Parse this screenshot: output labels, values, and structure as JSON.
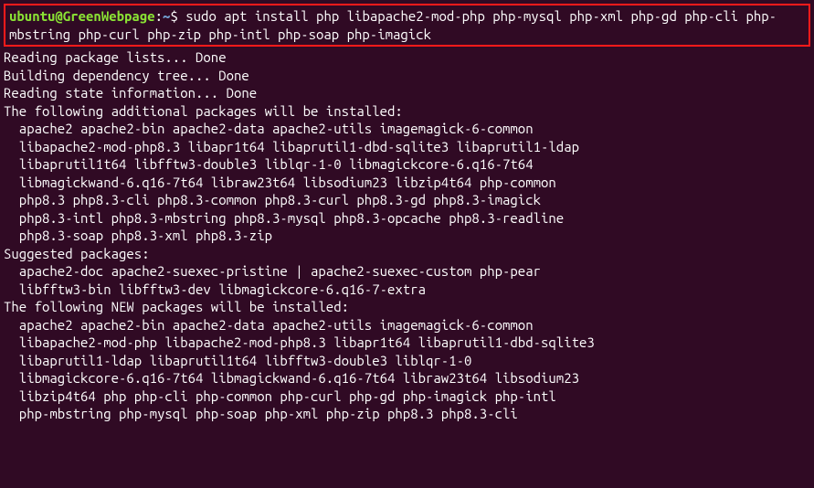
{
  "prompt": {
    "user": "ubuntu",
    "at": "@",
    "host": "GreenWebpage",
    "colon": ":",
    "path": "~",
    "dollar": "$ "
  },
  "command": "sudo apt install php libapache2-mod-php php-mysql php-xml php-gd php-cli php-mbstring php-curl php-zip php-intl php-soap php-imagick",
  "output": {
    "line1": "Reading package lists... Done",
    "line2": "Building dependency tree... Done",
    "line3": "Reading state information... Done",
    "line4": "The following additional packages will be installed:",
    "additional": "  apache2 apache2-bin apache2-data apache2-utils imagemagick-6-common\n  libapache2-mod-php8.3 libapr1t64 libaprutil1-dbd-sqlite3 libaprutil1-ldap\n  libaprutil1t64 libfftw3-double3 liblqr-1-0 libmagickcore-6.q16-7t64\n  libmagickwand-6.q16-7t64 libraw23t64 libsodium23 libzip4t64 php-common\n  php8.3 php8.3-cli php8.3-common php8.3-curl php8.3-gd php8.3-imagick\n  php8.3-intl php8.3-mbstring php8.3-mysql php8.3-opcache php8.3-readline\n  php8.3-soap php8.3-xml php8.3-zip",
    "line5": "Suggested packages:",
    "suggested": "  apache2-doc apache2-suexec-pristine | apache2-suexec-custom php-pear\n  libfftw3-bin libfftw3-dev libmagickcore-6.q16-7-extra",
    "line6": "The following NEW packages will be installed:",
    "newpkgs": "  apache2 apache2-bin apache2-data apache2-utils imagemagick-6-common\n  libapache2-mod-php libapache2-mod-php8.3 libapr1t64 libaprutil1-dbd-sqlite3\n  libaprutil1-ldap libaprutil1t64 libfftw3-double3 liblqr-1-0\n  libmagickcore-6.q16-7t64 libmagickwand-6.q16-7t64 libraw23t64 libsodium23\n  libzip4t64 php php-cli php-common php-curl php-gd php-imagick php-intl\n  php-mbstring php-mysql php-soap php-xml php-zip php8.3 php8.3-cli"
  }
}
